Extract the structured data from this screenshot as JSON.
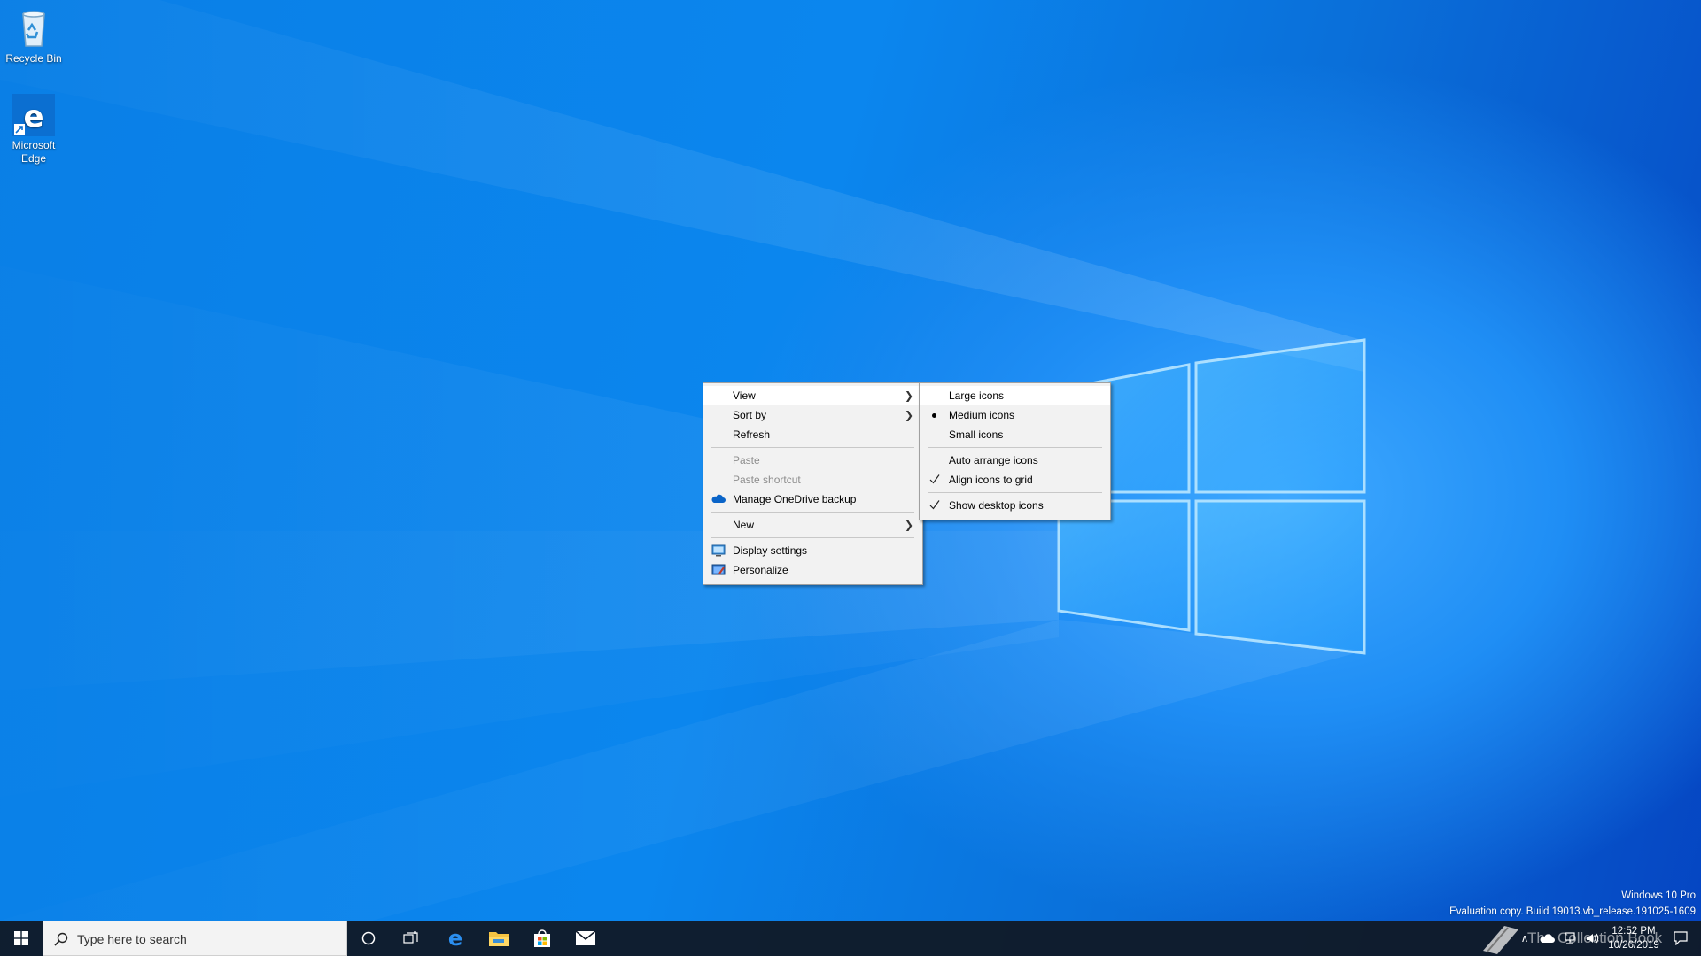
{
  "desktop": {
    "icons": [
      {
        "label": "Recycle Bin",
        "icon": "recycle-bin-icon"
      },
      {
        "label": "Microsoft Edge",
        "icon": "edge-icon"
      }
    ]
  },
  "context_menu": {
    "items": [
      {
        "label": "View",
        "has_submenu": true,
        "highlighted": true
      },
      {
        "label": "Sort by",
        "has_submenu": true
      },
      {
        "label": "Refresh"
      },
      {
        "label": "Paste",
        "disabled": true
      },
      {
        "label": "Paste shortcut",
        "disabled": true
      },
      {
        "label": "Manage OneDrive backup",
        "icon": "onedrive-icon"
      },
      {
        "label": "New",
        "has_submenu": true
      },
      {
        "label": "Display settings",
        "icon": "display-settings-icon"
      },
      {
        "label": "Personalize",
        "icon": "personalize-icon"
      }
    ]
  },
  "view_submenu": {
    "items": [
      {
        "label": "Large icons",
        "highlighted": true
      },
      {
        "label": "Medium icons",
        "selected": true
      },
      {
        "label": "Small icons"
      },
      {
        "label": "Auto arrange icons"
      },
      {
        "label": "Align icons to grid",
        "checked": true
      },
      {
        "label": "Show desktop icons",
        "checked": true
      }
    ]
  },
  "taskbar": {
    "search_placeholder": "Type here to search",
    "pinned": [
      "cortana-icon",
      "task-view-icon",
      "edge-icon",
      "file-explorer-icon",
      "store-icon",
      "mail-icon"
    ],
    "clock_time": "12:52 PM",
    "clock_date": "10/26/2019"
  },
  "watermark": {
    "edition": "Windows 10 Pro",
    "build": "Evaluation copy. Build 19013.vb_release.191025-1609",
    "site": "The Collection Book"
  },
  "colors": {
    "wallpaper_blue": "#0a7fe6",
    "menu_bg": "#f2f2f2",
    "menu_highlight": "#ffffff",
    "taskbar_bg": "#101a28",
    "edge_blue": "#0b6fd1"
  }
}
